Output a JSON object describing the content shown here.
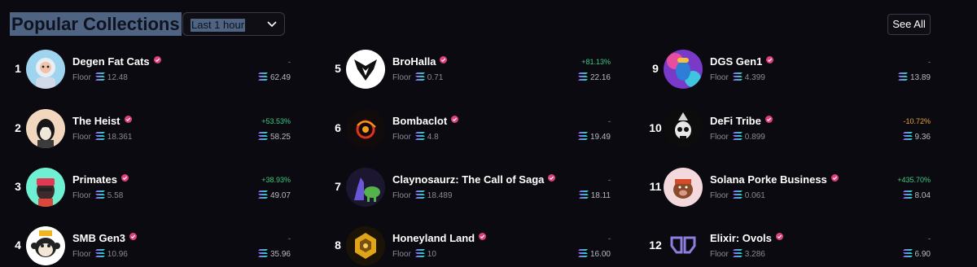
{
  "header": {
    "title": "Popular Collections",
    "timeframe": "Last 1 hour",
    "see_all": "See All"
  },
  "floor_label": "Floor",
  "colors": {
    "background": "#0b0a10",
    "positive": "#3ecb85",
    "negative": "#e8a23a",
    "verified": "#e0407a",
    "selection": "#4f6382"
  },
  "columns": [
    [
      {
        "rank": "1",
        "name": "Degen Fat Cats",
        "floor": "12.48",
        "change": "-",
        "volume": "62.49",
        "icon": "cat-astronaut-icon"
      },
      {
        "rank": "2",
        "name": "The Heist",
        "floor": "18.361",
        "change": "+53.53%",
        "volume": "58.25",
        "icon": "ape-heist-icon"
      },
      {
        "rank": "3",
        "name": "Primates",
        "floor": "5.58",
        "change": "+38.93%",
        "volume": "49.07",
        "icon": "primate-icon"
      },
      {
        "rank": "4",
        "name": "SMB Gen3",
        "floor": "10.96",
        "change": "-",
        "volume": "35.96",
        "icon": "monkey-icon"
      }
    ],
    [
      {
        "rank": "5",
        "name": "BroHalla",
        "floor": "0.71",
        "change": "+81.13%",
        "volume": "22.16",
        "icon": "brohalla-logo-icon"
      },
      {
        "rank": "6",
        "name": "Bombaclot",
        "floor": "4.8",
        "change": "-",
        "volume": "19.49",
        "icon": "bombaclot-icon"
      },
      {
        "rank": "7",
        "name": "Claynosaurz: The Call of Saga",
        "floor": "18.489",
        "change": "-",
        "volume": "18.11",
        "icon": "dinosaur-icon"
      },
      {
        "rank": "8",
        "name": "Honeyland Land",
        "floor": "10",
        "change": "-",
        "volume": "16.00",
        "icon": "honeycomb-icon"
      }
    ],
    [
      {
        "rank": "9",
        "name": "DGS Gen1",
        "floor": "4.399",
        "change": "-",
        "volume": "13.89",
        "icon": "genie-icon"
      },
      {
        "rank": "10",
        "name": "DeFi Tribe",
        "floor": "0.899",
        "change": "-10.72%",
        "volume": "9.36",
        "icon": "skull-warrior-icon"
      },
      {
        "rank": "11",
        "name": "Solana Porke Business",
        "floor": "0.061",
        "change": "+435.70%",
        "volume": "8.04",
        "icon": "pig-icon"
      },
      {
        "rank": "12",
        "name": "Elixir: Ovols",
        "floor": "3.286",
        "change": "-",
        "volume": "6.90",
        "icon": "owl-eyes-icon"
      }
    ]
  ]
}
